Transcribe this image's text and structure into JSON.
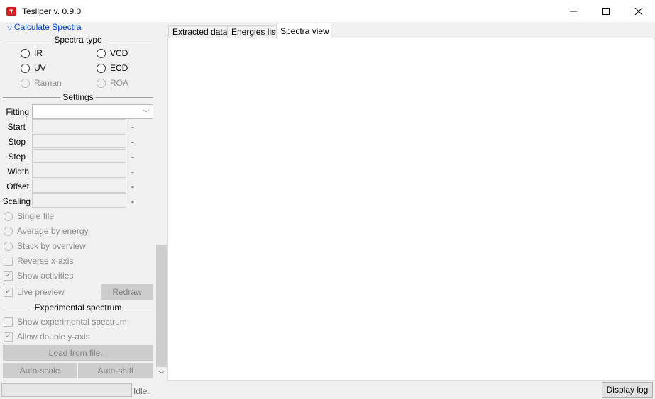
{
  "window": {
    "title": "Tesliper v. 0.9.0"
  },
  "panel": {
    "header": "Calculate Spectra",
    "spectra_type": {
      "title": "Spectra type",
      "options": [
        "IR",
        "VCD",
        "UV",
        "ECD",
        "Raman",
        "ROA"
      ]
    },
    "settings": {
      "title": "Settings",
      "fitting_label": "Fitting",
      "fitting_value": "",
      "fields": [
        {
          "label": "Start",
          "unit": "-"
        },
        {
          "label": "Stop",
          "unit": "-"
        },
        {
          "label": "Step",
          "unit": "-"
        },
        {
          "label": "Width",
          "unit": "-"
        },
        {
          "label": "Offset",
          "unit": "-"
        },
        {
          "label": "Scaling",
          "unit": "-"
        }
      ]
    },
    "mode_options": [
      "Single file",
      "Average by energy",
      "Stack by overview"
    ],
    "reverse_x": "Reverse x-axis",
    "show_activities": "Show activities",
    "live_preview": "Live preview",
    "redraw": "Redraw",
    "experimental": {
      "title": "Experimental spectrum",
      "show": "Show experimental spectrum",
      "double_y": "Allow double y-axis",
      "load": "Load from file...",
      "auto_scale": "Auto-scale",
      "auto_shift": "Auto-shift"
    }
  },
  "tabs": [
    "Extracted data",
    "Energies list",
    "Spectra view"
  ],
  "active_tab": "Spectra view",
  "status": {
    "text": "Idle.",
    "display_log": "Display log"
  }
}
